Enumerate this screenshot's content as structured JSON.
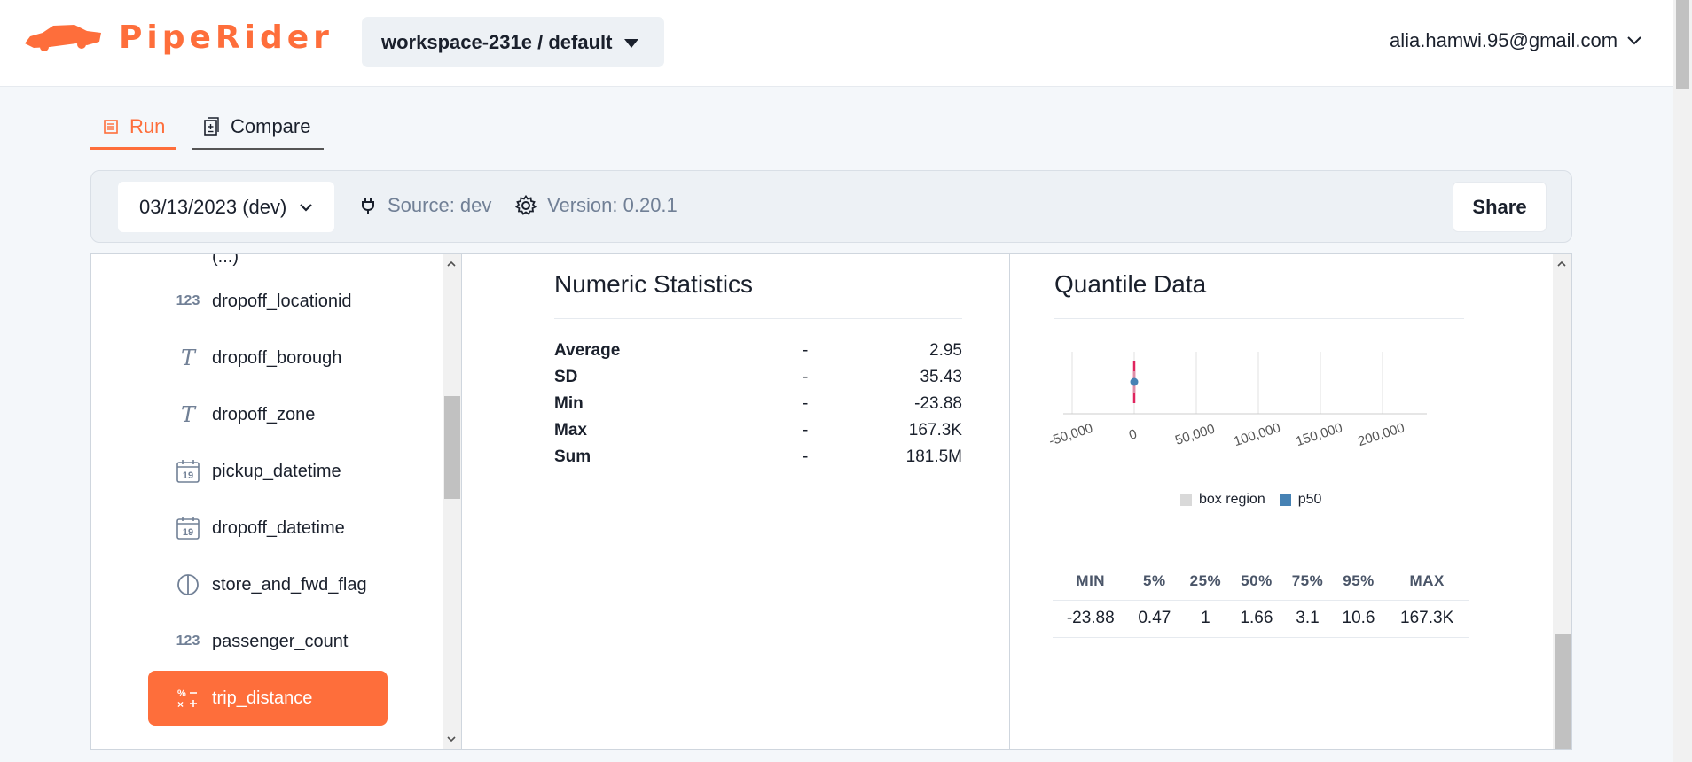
{
  "header": {
    "brand": "PipeRider",
    "workspace": "workspace-231e / default",
    "user_email": "alia.hamwi.95@gmail.com"
  },
  "tabs": [
    {
      "label": "Run",
      "active": true
    },
    {
      "label": "Compare",
      "active": false
    }
  ],
  "filter": {
    "run_date": "03/13/2023 (dev)",
    "source": "Source: dev",
    "version": "Version: 0.20.1",
    "share_label": "Share"
  },
  "sidebar": {
    "items": [
      {
        "label": "dropoff_locationid",
        "type_icon": "numeric-icon",
        "icon_text": "123"
      },
      {
        "label": "dropoff_borough",
        "type_icon": "text-type-icon",
        "icon_text": "T"
      },
      {
        "label": "dropoff_zone",
        "type_icon": "text-type-icon",
        "icon_text": "T"
      },
      {
        "label": "pickup_datetime",
        "type_icon": "calendar-icon",
        "icon_text": "19"
      },
      {
        "label": "dropoff_datetime",
        "type_icon": "calendar-icon",
        "icon_text": "19"
      },
      {
        "label": "store_and_fwd_flag",
        "type_icon": "boolean-icon",
        "icon_text": ""
      },
      {
        "label": "passenger_count",
        "type_icon": "numeric-icon",
        "icon_text": "123"
      },
      {
        "label": "trip_distance",
        "type_icon": "decimal-icon",
        "icon_text": "",
        "active": true
      }
    ]
  },
  "numeric_stats": {
    "title": "Numeric Statistics",
    "rows": [
      {
        "label": "Average",
        "dash": "-",
        "value": "2.95"
      },
      {
        "label": "SD",
        "dash": "-",
        "value": "35.43"
      },
      {
        "label": "Min",
        "dash": "-",
        "value": "-23.88"
      },
      {
        "label": "Max",
        "dash": "-",
        "value": "167.3K"
      },
      {
        "label": "Sum",
        "dash": "-",
        "value": "181.5M"
      }
    ]
  },
  "quantile": {
    "title": "Quantile Data",
    "legend": [
      "box region",
      "p50"
    ],
    "colors": {
      "box_region": "#d9d9d9",
      "p50": "#4682b4",
      "whisker": "#e0245e"
    },
    "headers": [
      "MIN",
      "5%",
      "25%",
      "50%",
      "75%",
      "95%",
      "MAX"
    ],
    "values": [
      "-23.88",
      "0.47",
      "1",
      "1.66",
      "3.1",
      "10.6",
      "167.3K"
    ]
  },
  "chart_data": {
    "type": "box",
    "title": "",
    "xlabel": "",
    "ylabel": "",
    "x_ticks": [
      "-50,000",
      "0",
      "50,000",
      "100,000",
      "150,000",
      "200,000"
    ],
    "xlim": [
      -50000,
      200000
    ],
    "min": -23.88,
    "p5": 0.47,
    "p25": 1,
    "p50": 1.66,
    "p75": 3.1,
    "p95": 10.6,
    "max": 167300,
    "grid": true,
    "legend": "bottom"
  },
  "colors": {
    "accent": "#fe6e3b",
    "text": "#1a202c",
    "muted": "#718096"
  }
}
